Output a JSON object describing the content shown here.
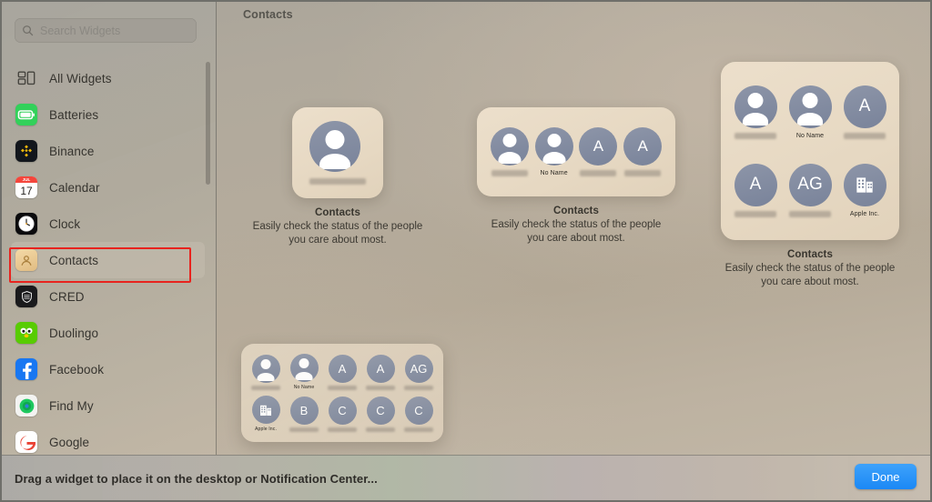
{
  "window": {
    "accent_blue": "#1b88f5",
    "annotation_color": "#e8231e"
  },
  "sidebar": {
    "search": {
      "placeholder": "Search Widgets",
      "value": "",
      "icon": "search-icon"
    },
    "items": [
      {
        "label": "All Widgets",
        "icon": "all-widgets-icon",
        "selected": false
      },
      {
        "label": "Batteries",
        "icon": "batteries-icon",
        "selected": false
      },
      {
        "label": "Binance",
        "icon": "binance-icon",
        "selected": false
      },
      {
        "label": "Calendar",
        "icon": "calendar-icon",
        "selected": false,
        "icon_text_month": "JUL",
        "icon_text_day": "17"
      },
      {
        "label": "Clock",
        "icon": "clock-icon",
        "selected": false
      },
      {
        "label": "Contacts",
        "icon": "contacts-icon",
        "selected": true
      },
      {
        "label": "CRED",
        "icon": "cred-icon",
        "selected": false
      },
      {
        "label": "Duolingo",
        "icon": "duolingo-icon",
        "selected": false
      },
      {
        "label": "Facebook",
        "icon": "facebook-icon",
        "selected": false
      },
      {
        "label": "Find My",
        "icon": "find-my-icon",
        "selected": false
      },
      {
        "label": "Google",
        "icon": "google-icon",
        "selected": false
      }
    ]
  },
  "gallery": {
    "title": "Contacts",
    "widgets": [
      {
        "size": "small",
        "name": "Contacts",
        "description": "Easily check the status of the people\nyou care about most.",
        "contacts": [
          {
            "type": "photo",
            "label": "",
            "label_redacted": true
          }
        ]
      },
      {
        "size": "medium",
        "name": "Contacts",
        "description": "Easily check the status of the people\nyou care about most.",
        "contacts": [
          {
            "type": "photo",
            "label": "",
            "label_redacted": true
          },
          {
            "type": "photo",
            "label": "No Name",
            "label_redacted": false
          },
          {
            "type": "initial",
            "label": "",
            "initials": "A",
            "label_redacted": true
          },
          {
            "type": "initial",
            "label": "",
            "initials": "A",
            "label_redacted": true
          }
        ]
      },
      {
        "size": "large",
        "name": "Contacts",
        "description": "Easily check the status of the people\nyou care about most.",
        "contacts": [
          {
            "type": "photo",
            "label": "",
            "label_redacted": true
          },
          {
            "type": "photo",
            "label": "No Name",
            "label_redacted": false
          },
          {
            "type": "initial",
            "label": "",
            "initials": "A",
            "label_redacted": true
          },
          {
            "type": "initial",
            "label": "",
            "initials": "A",
            "label_redacted": true
          },
          {
            "type": "initial",
            "label": "",
            "initials": "AG",
            "label_redacted": true
          },
          {
            "type": "company",
            "label": "Apple Inc.",
            "label_redacted": false
          }
        ]
      }
    ]
  },
  "drag_widget": {
    "size": "extra-large",
    "contacts": [
      {
        "type": "photo",
        "label": "",
        "label_redacted": true
      },
      {
        "type": "photo",
        "label": "No Name",
        "label_redacted": false
      },
      {
        "type": "initial",
        "label": "",
        "initials": "A",
        "label_redacted": true
      },
      {
        "type": "initial",
        "label": "",
        "initials": "A",
        "label_redacted": true
      },
      {
        "type": "initial",
        "label": "",
        "initials": "AG",
        "label_redacted": true
      },
      {
        "type": "company",
        "label": "Apple Inc.",
        "label_redacted": false
      },
      {
        "type": "initial",
        "label": "",
        "initials": "B",
        "label_redacted": true
      },
      {
        "type": "initial",
        "label": "",
        "initials": "C",
        "label_redacted": true
      },
      {
        "type": "initial",
        "label": "",
        "initials": "C",
        "label_redacted": true
      },
      {
        "type": "initial",
        "label": "",
        "initials": "C",
        "label_redacted": true
      }
    ]
  },
  "bottom_bar": {
    "hint": "Drag a widget to place it on the desktop or Notification Center...",
    "done_label": "Done"
  }
}
